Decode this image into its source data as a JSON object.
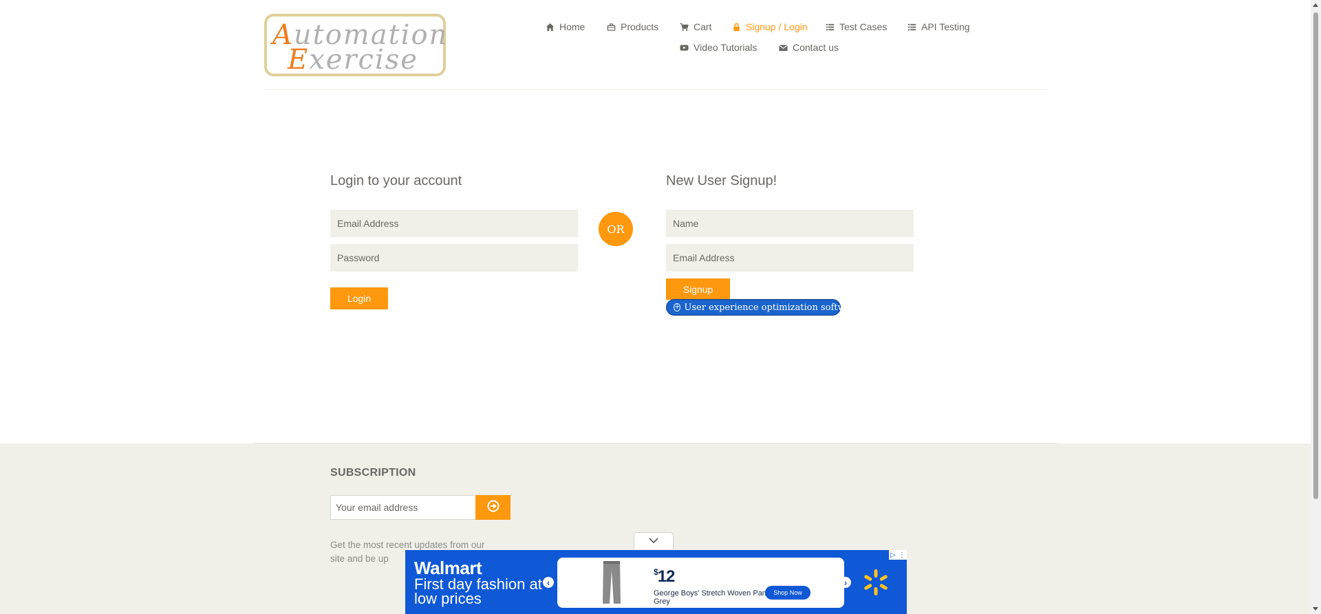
{
  "logo": {
    "line1_cap": "A",
    "line1_rest": "utomation",
    "line2_cap": "E",
    "line2_rest": "xercise"
  },
  "nav": {
    "home": "Home",
    "products": "Products",
    "cart": "Cart",
    "signup_login": "Signup / Login",
    "test_cases": "Test Cases",
    "api_testing": "API Testing",
    "video_tutorials": "Video Tutorials",
    "contact_us": "Contact us"
  },
  "login": {
    "title": "Login to your account",
    "email_placeholder": "Email Address",
    "password_placeholder": "Password",
    "button": "Login"
  },
  "or_label": "OR",
  "signup": {
    "title": "New User Signup!",
    "name_placeholder": "Name",
    "email_placeholder": "Email Address",
    "button": "Signup"
  },
  "ux_badge": "User experience optimization software",
  "footer": {
    "subscription_title": "SUBSCRIPTION",
    "email_placeholder": "Your email address",
    "description": "Get the most recent updates from our site and be up"
  },
  "ad": {
    "brand": "Walmart",
    "headline": "First day fashion at low prices",
    "price_symbol": "$",
    "price": "12",
    "product": "George Boys' Stretch Woven Pant Grey",
    "cta": "Shop Now"
  },
  "colors": {
    "accent": "#fe980f",
    "text": "#696763",
    "field_bg": "#f0f0e9",
    "ad_blue": "#0f58d6"
  }
}
